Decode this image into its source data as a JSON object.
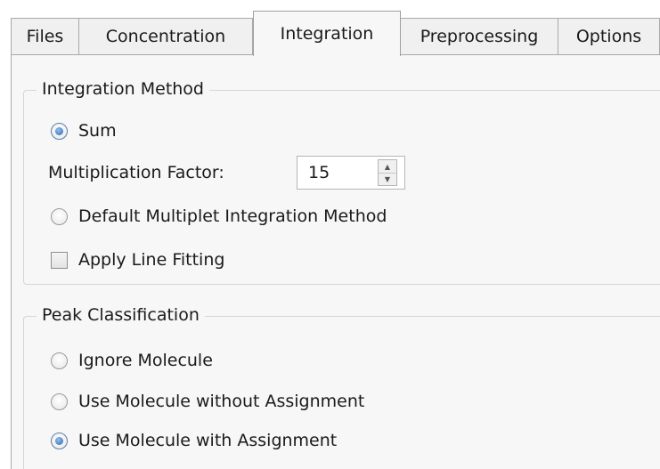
{
  "tabs": [
    {
      "label": "Files",
      "active": false
    },
    {
      "label": "Concentration",
      "active": false
    },
    {
      "label": "Integration",
      "active": true
    },
    {
      "label": "Preprocessing",
      "active": false
    },
    {
      "label": "Options",
      "active": false
    }
  ],
  "integration_method": {
    "title": "Integration Method",
    "sum_label": "Sum",
    "sum_selected": true,
    "multiplication_factor_label": "Multiplication Factor:",
    "multiplication_factor_value": "15",
    "default_multiplet_label": "Default Multiplet Integration Method",
    "default_multiplet_selected": false,
    "apply_line_fitting_label": "Apply Line Fitting",
    "apply_line_fitting_checked": false
  },
  "peak_classification": {
    "title": "Peak Classification",
    "options": [
      {
        "label": "Ignore Molecule",
        "selected": false
      },
      {
        "label": "Use Molecule without Assignment",
        "selected": false
      },
      {
        "label": "Use Molecule with Assignment",
        "selected": true
      }
    ]
  },
  "colors": {
    "panel_bg": "#f7f7f7",
    "tab_bg": "#f0f0f0",
    "radio_selected": "#2c66b2"
  },
  "icons": [
    "radio-button-icon",
    "checkbox-icon",
    "spin-up-arrow-icon",
    "spin-down-arrow-icon"
  ]
}
